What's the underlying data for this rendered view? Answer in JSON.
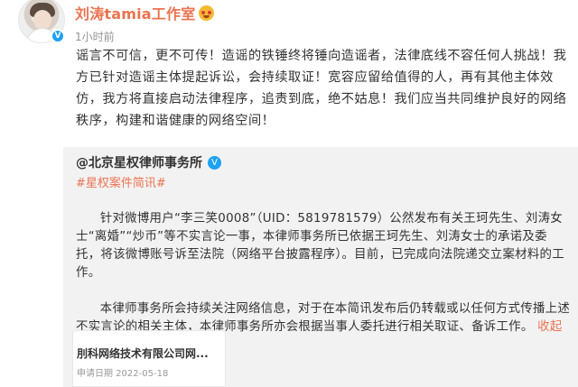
{
  "author": {
    "name": "刘涛tamia工作室",
    "emoji": "emoji-icon",
    "avatar_badge": "V"
  },
  "timestamp": "1小时前",
  "main_text": "谣言不可信，更不可传！造谣的铁锤终将锤向造谣者，法律底线不容任何人挑战！我方已针对造谣主体提起诉讼，会持续取证！宽容应留给值得的人，再有其他主体效仿，我方将直接启动法律程序，追责到底，绝不姑息！我们应当共同维护良好的网络秩序，构建和谐健康的网络空间！",
  "repost": {
    "author": "@北京星权律师事务所",
    "verified": "V",
    "hashtag": "#星权案件简讯#",
    "paragraph1": "针对微博用户“李三笑0008”（UID：5819781579）公然发布有关王珂先生、刘涛女士“离婚”“炒币”等不实言论一事，本律师事务所已依据王珂先生、刘涛女士的承诺及委托，将该微博账号诉至法院（网络平台披露程序）。目前，已完成向法院递交立案材料的工作。",
    "paragraph2": "本律师事务所会持续关注网络信息，对于在本简讯发布后仍转载或以任何方式传播上述不实言论的相关主体，本律师事务所亦会根据当事人委托进行相关取证、备诉工作。",
    "collapse_label": "收起",
    "card": {
      "title": "刖科网络技术有限公司网...",
      "subtitle_label": "申请日期",
      "subtitle_date": "2022-05-18"
    }
  },
  "colors": {
    "accent": "#eb7350",
    "verified": "#1da1f2",
    "repost_bg": "#f2f2f2"
  }
}
